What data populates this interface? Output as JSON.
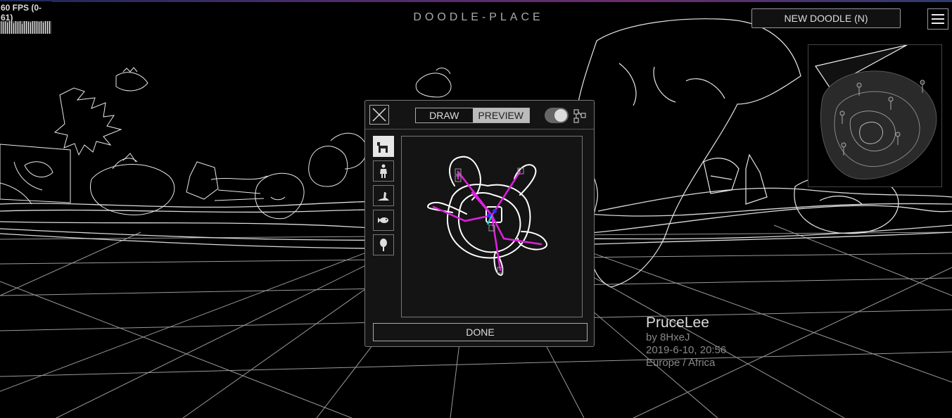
{
  "fps": {
    "label": "60 FPS (0-61)"
  },
  "header": {
    "site_title": "DOODLE-PLACE",
    "new_doodle_label": "NEW DOODLE (N)",
    "menu_icon": "hamburger-icon"
  },
  "doodle_info": {
    "name": "PruceLee",
    "author": "by 8HxeJ",
    "date": "2019-6-10, 20:56",
    "region": "Europe / Africa"
  },
  "editor": {
    "close_icon": "close-icon",
    "mode_tabs": [
      {
        "label": "DRAW",
        "selected": false
      },
      {
        "label": "PREVIEW",
        "selected": true
      }
    ],
    "toggle_on": true,
    "skeleton_tree_icon": "tree-structure-icon",
    "categories": [
      {
        "icon": "quadruped-icon",
        "active": true
      },
      {
        "icon": "human-icon",
        "active": false
      },
      {
        "icon": "bird-icon",
        "active": false
      },
      {
        "icon": "fish-icon",
        "active": false
      },
      {
        "icon": "tree-icon",
        "active": false
      }
    ],
    "done_label": "DONE"
  },
  "colors": {
    "background": "#000000",
    "panel": "#141414",
    "skeleton_bone": "#e020e0",
    "skeleton_root": "#20d0c0",
    "skeleton_joint": "#3030ff",
    "stroke": "#ffffff"
  }
}
